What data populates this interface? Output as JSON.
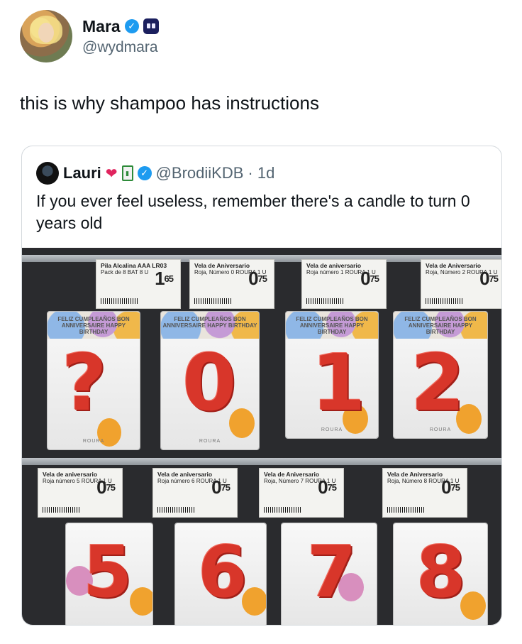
{
  "tweet": {
    "name": "Mara",
    "handle": "@wydmara",
    "text": "this is why shampoo has instructions"
  },
  "quoted": {
    "name": "Lauri",
    "handle": "@BrodiiKDB",
    "time": "· 1d",
    "text": "If you ever feel useless, remember there's a candle to turn 0 years old"
  },
  "photo": {
    "top_labels": [
      {
        "title": "Pila Alcalina AAA LR03",
        "sub": "Pack de 8 BAT 8 U",
        "price_int": "1",
        "price_dec": "65"
      },
      {
        "title": "Vela de Aniversario",
        "sub": "Roja, Número 0 ROURA 1 U",
        "price_int": "0",
        "price_dec": "75"
      },
      {
        "title": "Vela de aniversario",
        "sub": "Roja número 1 ROURA 1 U",
        "price_int": "0",
        "price_dec": "75"
      },
      {
        "title": "Vela de Aniversario",
        "sub": "Roja, Número 2 ROURA 1 U",
        "price_int": "0",
        "price_dec": "75"
      }
    ],
    "bottom_labels": [
      {
        "title": "Vela de aniversario",
        "sub": "Roja número 5 ROURA 1 U",
        "price_int": "0",
        "price_dec": "75"
      },
      {
        "title": "Vela de aniversario",
        "sub": "Roja número 6 ROURA 1 U",
        "price_int": "0",
        "price_dec": "75"
      },
      {
        "title": "Vela de Aniversario",
        "sub": "Roja, Número 7 ROURA 1 U",
        "price_int": "0",
        "price_dec": "75"
      },
      {
        "title": "Vela de Aniversario",
        "sub": "Roja, Número 8 ROURA 1 U",
        "price_int": "0",
        "price_dec": "75"
      }
    ],
    "top_digits": [
      "?",
      "0",
      "1",
      "2"
    ],
    "bottom_digits": [
      "5",
      "6",
      "7",
      "8"
    ],
    "banner_text": "FELIZ CUMPLEAÑOS BON ANNIVERSAIRE HAPPY BIRTHDAY",
    "brand": "ROURA"
  },
  "icons": [
    "verified-icon",
    "game-icon",
    "heart-icon",
    "juice-icon"
  ],
  "colors": {
    "verified": "#1d9bf0",
    "candle": "#d8362a",
    "secondary_text": "#536471"
  }
}
